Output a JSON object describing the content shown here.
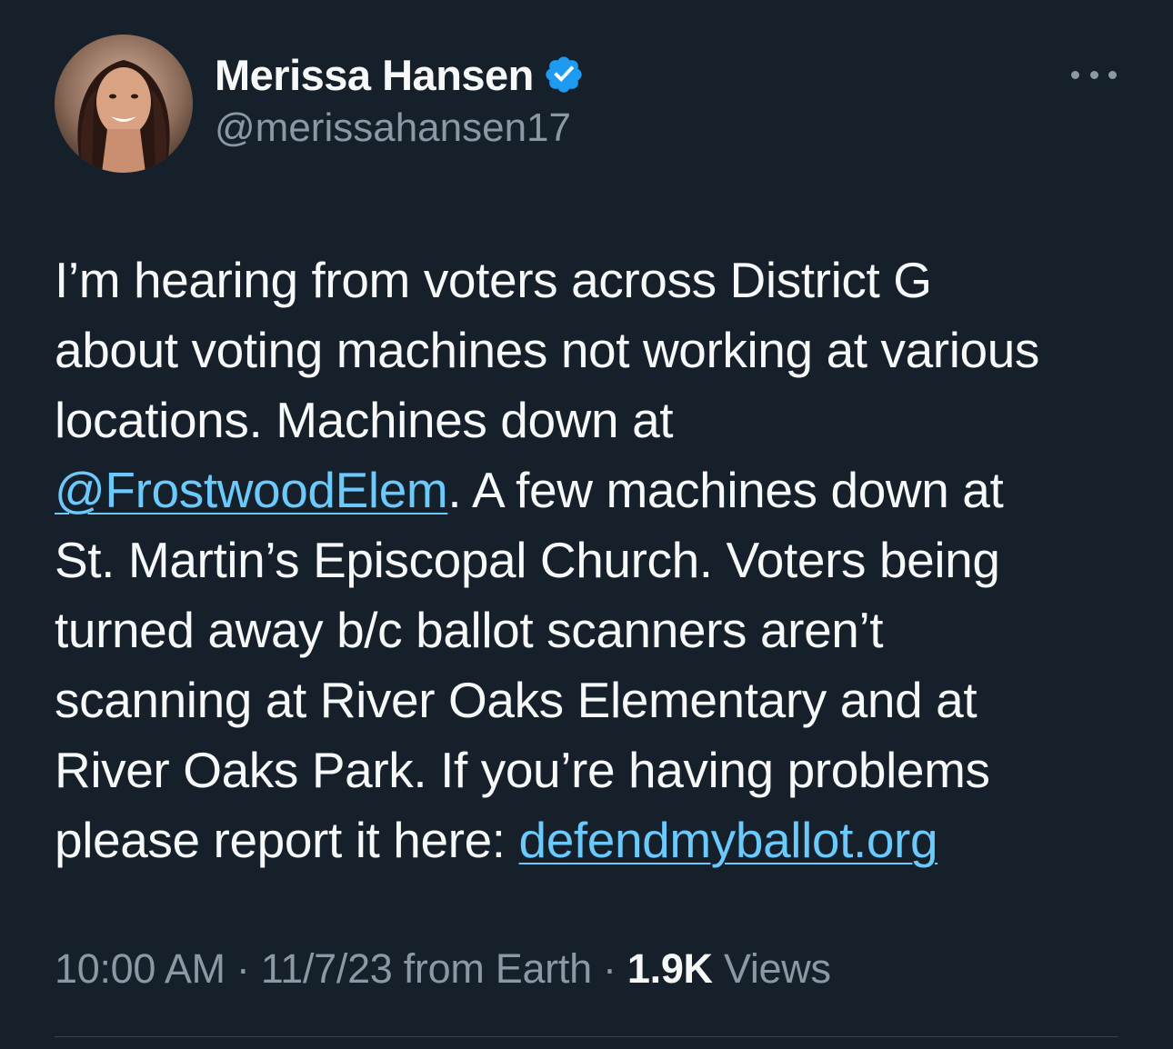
{
  "author": {
    "display_name": "Merissa Hansen",
    "handle": "@merissahansen17",
    "verified_icon": "verified-badge-icon",
    "avatar_icon": "profile-photo"
  },
  "menu": {
    "more_icon": "more-horizontal-icon"
  },
  "tweet": {
    "lines": [
      {
        "segments": [
          {
            "text": "I’m hearing from voters across District G",
            "link": false
          }
        ]
      },
      {
        "segments": [
          {
            "text": "about voting machines not working at various",
            "link": false
          }
        ]
      },
      {
        "segments": [
          {
            "text": "locations. Machines down at",
            "link": false
          }
        ]
      },
      {
        "segments": [
          {
            "text": "@FrostwoodElem",
            "link": true
          },
          {
            "text": ". A few machines down at",
            "link": false
          }
        ]
      },
      {
        "segments": [
          {
            "text": "St. Martin’s Episcopal Church. Voters being",
            "link": false
          }
        ]
      },
      {
        "segments": [
          {
            "text": "turned away b/c ballot scanners aren’t",
            "link": false
          }
        ]
      },
      {
        "segments": [
          {
            "text": "scanning at River Oaks Elementary and at",
            "link": false
          }
        ]
      },
      {
        "segments": [
          {
            "text": "River Oaks Park.  If you’re having problems",
            "link": false
          }
        ]
      },
      {
        "segments": [
          {
            "text": "please report it here: ",
            "link": false
          },
          {
            "text": "defendmyballot.org",
            "link": true
          }
        ]
      }
    ]
  },
  "meta": {
    "time": "10:00 AM",
    "separator": " · ",
    "date": "11/7/23",
    "source": " from Earth",
    "views_count": "1.9K",
    "views_label": " Views"
  },
  "colors": {
    "background": "#15202b",
    "text": "#f7f9f9",
    "secondary": "#8b98a5",
    "link": "#6bc9fb",
    "verified": "#1d9bf0"
  }
}
